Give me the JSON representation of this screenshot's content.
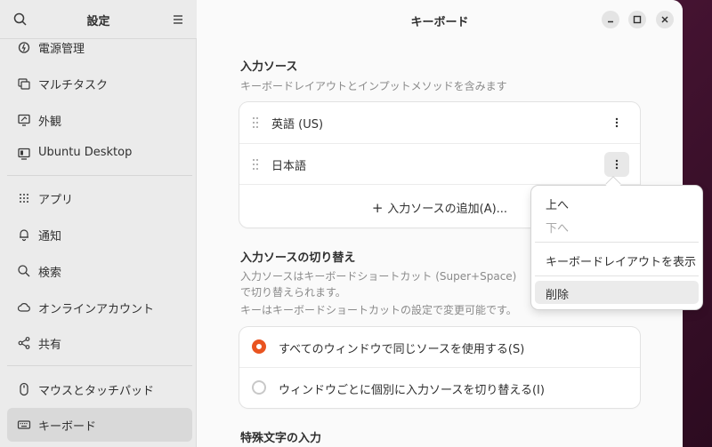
{
  "sidebar": {
    "title": "設定",
    "items": [
      {
        "label": "電源管理",
        "icon": "power-icon"
      },
      {
        "label": "マルチタスク",
        "icon": "multitasking-icon"
      },
      {
        "label": "外観",
        "icon": "appearance-icon"
      },
      {
        "label": "Ubuntu Desktop",
        "icon": "desktop-icon"
      },
      {
        "label": "アプリ",
        "icon": "apps-grid-icon"
      },
      {
        "label": "通知",
        "icon": "bell-icon"
      },
      {
        "label": "検索",
        "icon": "search-icon"
      },
      {
        "label": "オンラインアカウント",
        "icon": "cloud-icon"
      },
      {
        "label": "共有",
        "icon": "share-icon"
      },
      {
        "label": "マウスとタッチパッド",
        "icon": "mouse-icon"
      },
      {
        "label": "キーボード",
        "icon": "keyboard-icon"
      }
    ]
  },
  "window": {
    "title": "キーボード"
  },
  "input_sources": {
    "title": "入力ソース",
    "description": "キーボードレイアウトとインプットメソッドを含みます",
    "sources": [
      "英語 (US)",
      "日本語"
    ],
    "add_label": "入力ソースの追加(A)..."
  },
  "switching": {
    "title": "入力ソースの切り替え",
    "description_line1": "入力ソースはキーボードショートカット (Super+Space) で切り替えられます。",
    "description_line2": "キーはキーボードショートカットの設定で変更可能です。",
    "options": [
      {
        "label": "すべてのウィンドウで同じソースを使用する(S)",
        "checked": true
      },
      {
        "label": "ウィンドウごとに個別に入力ソースを切り替える(I)",
        "checked": false
      }
    ]
  },
  "special_chars": {
    "title": "特殊文字の入力"
  },
  "popover": {
    "items": [
      "上へ",
      "下へ",
      "キーボードレイアウトを表示",
      "削除"
    ]
  },
  "colors": {
    "accent": "#e95420"
  }
}
